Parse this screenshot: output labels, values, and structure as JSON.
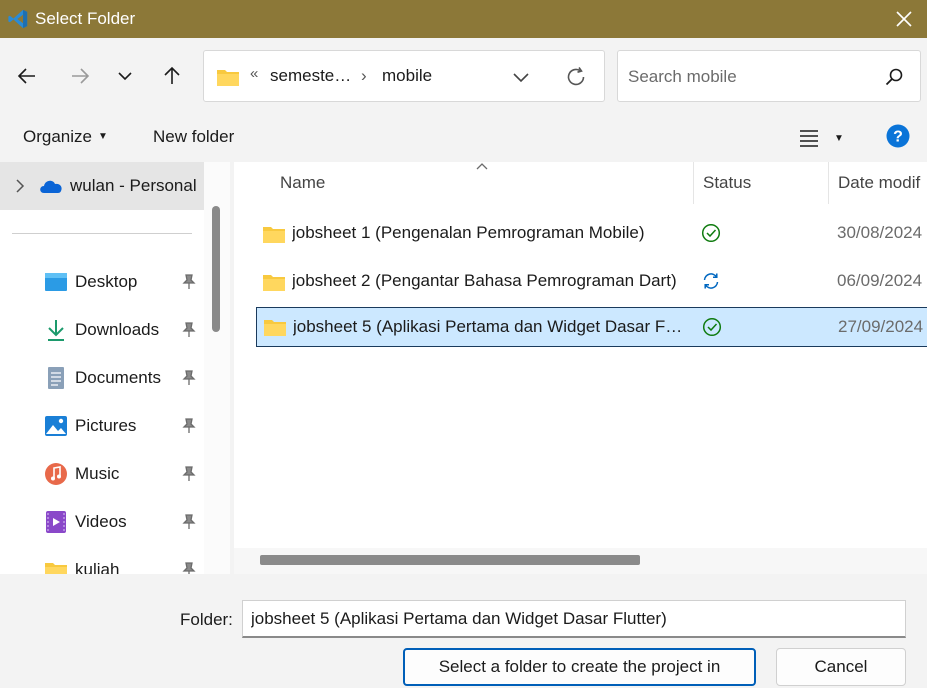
{
  "window": {
    "title": "Select Folder",
    "close_icon": "close-icon",
    "app_icon": "vscode-icon"
  },
  "nav": {
    "back_icon": "arrow-left-icon",
    "forward_icon": "arrow-right-icon",
    "recent_icon": "chevron-down-icon",
    "up_icon": "arrow-up-icon"
  },
  "address": {
    "overflow": "«",
    "crumbs": [
      "semeste…",
      "mobile"
    ],
    "separator": "›",
    "dropdown_icon": "chevron-down-icon",
    "refresh_icon": "refresh-icon"
  },
  "search": {
    "placeholder": "Search mobile",
    "icon": "search-icon"
  },
  "toolbar": {
    "organize_label": "Organize",
    "new_folder_label": "New folder",
    "view_icon": "view-list-icon",
    "help_icon": "help-icon"
  },
  "navpane": {
    "onedrive_label": "wulan - Personal",
    "quick_access": [
      {
        "label": "Desktop",
        "icon": "desktop-icon"
      },
      {
        "label": "Downloads",
        "icon": "download-icon"
      },
      {
        "label": "Documents",
        "icon": "documents-icon"
      },
      {
        "label": "Pictures",
        "icon": "pictures-icon"
      },
      {
        "label": "Music",
        "icon": "music-icon"
      },
      {
        "label": "Videos",
        "icon": "videos-icon"
      },
      {
        "label": "kuliah",
        "icon": "folder-icon"
      }
    ]
  },
  "filelist": {
    "columns": [
      "Name",
      "Status",
      "Date modif"
    ],
    "rows": [
      {
        "name": "jobsheet 1 (Pengenalan Pemrograman Mobile)",
        "status": "synced",
        "date": "30/08/2024"
      },
      {
        "name": "jobsheet 2 (Pengantar Bahasa Pemrograman Dart)",
        "status": "syncing",
        "date": "06/09/2024"
      },
      {
        "name": "jobsheet 5 (Aplikasi Pertama dan Widget Dasar Flutter)",
        "status": "synced",
        "date": "27/09/2024",
        "selected": true
      }
    ]
  },
  "bottom": {
    "folder_label": "Folder:",
    "folder_value": "jobsheet 5 (Aplikasi Pertama dan Widget Dasar Flutter)",
    "select_label": "Select a folder to create the project in",
    "cancel_label": "Cancel"
  },
  "colors": {
    "titlebar": "#8c7838",
    "selection": "#cce8ff",
    "accent": "#005fb8",
    "sync_green": "#0f7b0f",
    "sync_blue": "#0067c0"
  }
}
